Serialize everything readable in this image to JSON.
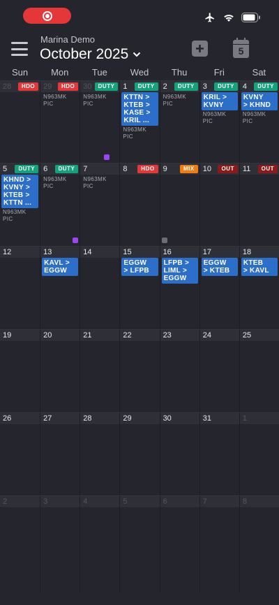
{
  "header": {
    "account_name": "Marina Demo",
    "month_title": "October 2025",
    "today_number": "5"
  },
  "weekdays": [
    "Sun",
    "Mon",
    "Tue",
    "Wed",
    "Thu",
    "Fri",
    "Sat"
  ],
  "colors": {
    "background": "#25252d",
    "event_blue": "#2b6fcb",
    "HDO": "#e5373a",
    "DUTY": "#13a27c",
    "MIX": "#ef7d11",
    "OUT": "#8c1a1a",
    "marker_purple": "#9b46f3",
    "marker_gray": "#6d6d75"
  },
  "weeks": [
    [
      {
        "num": "28",
        "muted": true,
        "badge": "HDO"
      },
      {
        "num": "29",
        "muted": true,
        "badge": "HDO",
        "meta": [
          "N963MK",
          "PIC"
        ]
      },
      {
        "num": "30",
        "muted": true,
        "badge": "DUTY",
        "meta": [
          "N963MK",
          "PIC"
        ]
      },
      {
        "num": "1",
        "badge": "DUTY",
        "event": [
          "KTTN >",
          "KTEB >",
          "KASE >",
          "KRIL ..."
        ],
        "meta": [
          "N963MK",
          "PIC"
        ]
      },
      {
        "num": "2",
        "badge": "DUTY",
        "meta": [
          "N963MK",
          "PIC"
        ]
      },
      {
        "num": "3",
        "badge": "DUTY",
        "event": [
          "KRIL >",
          "KVNY"
        ],
        "meta": [
          "N963MK",
          "PIC"
        ]
      },
      {
        "num": "4",
        "badge": "DUTY",
        "event": [
          "KVNY",
          "> KHND"
        ],
        "meta": [
          "N963MK",
          "PIC"
        ]
      }
    ],
    [
      {
        "num": "5",
        "badge": "DUTY",
        "event": [
          "KHND >",
          "KVNY >",
          "KTEB >",
          "KTTN ..."
        ],
        "meta": [
          "N963MK",
          "PIC"
        ]
      },
      {
        "num": "6",
        "badge": "DUTY",
        "meta": [
          "N963MK",
          "PIC"
        ]
      },
      {
        "num": "7",
        "meta": [
          "N963MK",
          "PIC"
        ]
      },
      {
        "num": "8",
        "badge": "HDO"
      },
      {
        "num": "9",
        "badge": "MIX"
      },
      {
        "num": "10",
        "badge": "OUT"
      },
      {
        "num": "11",
        "badge": "OUT"
      }
    ],
    [
      {
        "num": "12"
      },
      {
        "num": "13",
        "event": [
          "KAVL >",
          "EGGW"
        ]
      },
      {
        "num": "14"
      },
      {
        "num": "15",
        "event": [
          "EGGW",
          "> LFPB"
        ]
      },
      {
        "num": "16",
        "event": [
          "LFPB >",
          "LIML >",
          "EGGW"
        ]
      },
      {
        "num": "17",
        "event": [
          "EGGW",
          "> KTEB"
        ]
      },
      {
        "num": "18",
        "event": [
          "KTEB",
          "> KAVL"
        ]
      }
    ],
    [
      {
        "num": "19"
      },
      {
        "num": "20"
      },
      {
        "num": "21"
      },
      {
        "num": "22"
      },
      {
        "num": "23"
      },
      {
        "num": "24"
      },
      {
        "num": "25"
      }
    ],
    [
      {
        "num": "26"
      },
      {
        "num": "27"
      },
      {
        "num": "28"
      },
      {
        "num": "29"
      },
      {
        "num": "30"
      },
      {
        "num": "31"
      },
      {
        "num": "1",
        "muted": true
      }
    ],
    [
      {
        "num": "2",
        "muted": true
      },
      {
        "num": "3",
        "muted": true
      },
      {
        "num": "4",
        "muted": true
      },
      {
        "num": "5",
        "muted": true
      },
      {
        "num": "6",
        "muted": true
      },
      {
        "num": "7",
        "muted": true
      },
      {
        "num": "8",
        "muted": true
      }
    ]
  ]
}
